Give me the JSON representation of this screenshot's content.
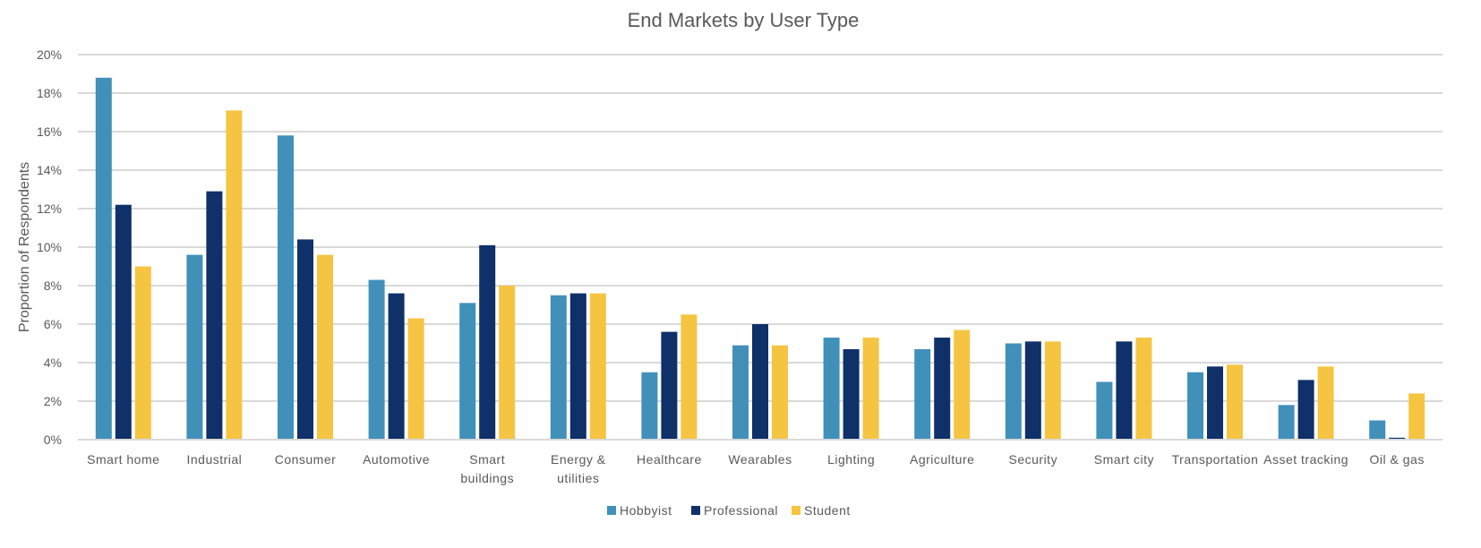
{
  "chart_data": {
    "type": "bar",
    "title": "End Markets by User Type",
    "xlabel": "",
    "ylabel": "Proportion of Respondents",
    "ylim": [
      0,
      20
    ],
    "yticks": [
      "0%",
      "2%",
      "4%",
      "6%",
      "8%",
      "10%",
      "12%",
      "14%",
      "16%",
      "18%",
      "20%"
    ],
    "ytick_values": [
      0,
      2,
      4,
      6,
      8,
      10,
      12,
      14,
      16,
      18,
      20
    ],
    "grid": true,
    "legend_position": "bottom",
    "categories": [
      [
        "Smart home"
      ],
      [
        "Industrial"
      ],
      [
        "Consumer"
      ],
      [
        "Automotive"
      ],
      [
        "Smart",
        "buildings"
      ],
      [
        "Energy &",
        "utilities"
      ],
      [
        "Healthcare"
      ],
      [
        "Wearables"
      ],
      [
        "Lighting"
      ],
      [
        "Agriculture"
      ],
      [
        "Security"
      ],
      [
        "Smart city"
      ],
      [
        "Transportation"
      ],
      [
        "Asset tracking"
      ],
      [
        "Oil & gas"
      ]
    ],
    "series": [
      {
        "name": "Hobbyist",
        "color": "#4190BA",
        "values": [
          18.8,
          9.6,
          15.8,
          8.3,
          7.1,
          7.5,
          3.5,
          4.9,
          5.3,
          4.7,
          5.0,
          3.0,
          3.5,
          1.8,
          1.0
        ]
      },
      {
        "name": "Professional",
        "color": "#0F3068",
        "values": [
          12.2,
          12.9,
          10.4,
          7.6,
          10.1,
          7.6,
          5.6,
          6.0,
          4.7,
          5.3,
          5.1,
          5.1,
          3.8,
          3.1,
          0.1
        ]
      },
      {
        "name": "Student",
        "color": "#F5C542",
        "values": [
          9.0,
          17.1,
          9.6,
          6.3,
          8.0,
          7.6,
          6.5,
          4.9,
          5.3,
          5.7,
          5.1,
          5.3,
          3.9,
          3.8,
          2.4
        ]
      }
    ]
  }
}
